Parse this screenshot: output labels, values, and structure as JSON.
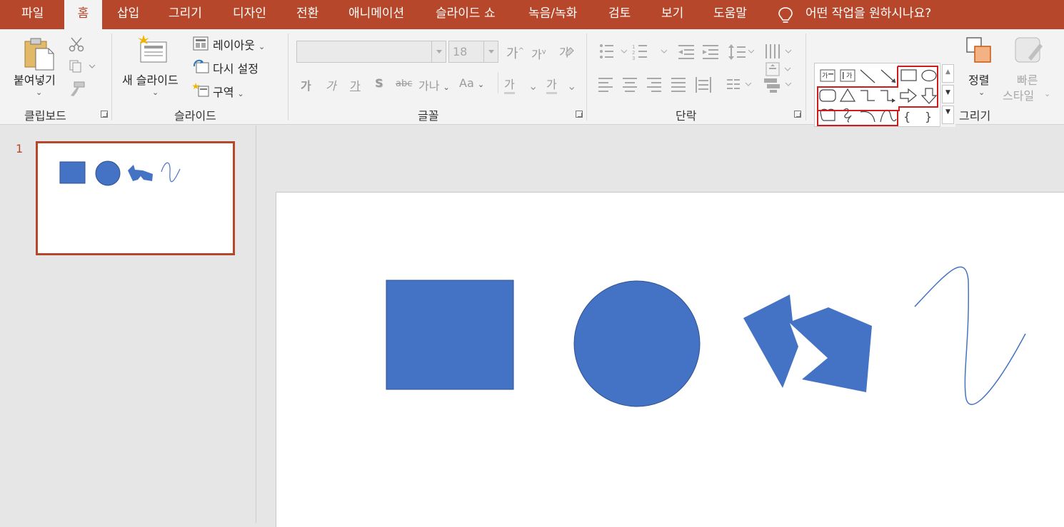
{
  "tabs": [
    {
      "label": "파일",
      "active": false
    },
    {
      "label": "홈",
      "active": true
    },
    {
      "label": "삽입",
      "active": false
    },
    {
      "label": "그리기",
      "active": false
    },
    {
      "label": "디자인",
      "active": false
    },
    {
      "label": "전환",
      "active": false
    },
    {
      "label": "애니메이션",
      "active": false
    },
    {
      "label": "슬라이드 쇼",
      "active": false
    },
    {
      "label": "녹음/녹화",
      "active": false
    },
    {
      "label": "검토",
      "active": false
    },
    {
      "label": "보기",
      "active": false
    },
    {
      "label": "도움말",
      "active": false
    }
  ],
  "tell_me": {
    "text": "어떤 작업을 원하시나요?",
    "icon": "lightbulb-icon"
  },
  "clipboard": {
    "paste_label": "붙여넣기",
    "group_label": "클립보드",
    "icons": [
      "paste-icon",
      "cut-icon",
      "copy-icon",
      "format-painter-icon"
    ]
  },
  "slides_group": {
    "new_slide_label": "새 슬라이드",
    "layout_label": "레이아웃",
    "reset_label": "다시 설정",
    "section_label": "구역",
    "group_label": "슬라이드"
  },
  "font": {
    "font_name": "",
    "font_size": "18",
    "increase_label": "가",
    "decrease_label": "가",
    "clear_label": "가",
    "bold_label": "가",
    "italic_label": "가",
    "underline_label": "가",
    "shadow_label": "S",
    "strike_label": "abc",
    "spacing_label": "가나",
    "case_label": "Aa",
    "highlight_label": "가",
    "color_label": "가",
    "group_label": "글꼴"
  },
  "paragraph": {
    "group_label": "단락"
  },
  "drawing": {
    "arrange_label": "정렬",
    "quick_styles_line1": "빠른",
    "quick_styles_line2": "스타일",
    "group_label": "그리기"
  },
  "slide_panel": {
    "slide_number": "1"
  },
  "slide": {
    "shapes": [
      "rectangle",
      "oval",
      "freeform",
      "curve"
    ],
    "shape_fill": "#4472c4",
    "shape_stroke": "#2f528f"
  },
  "colors": {
    "accent": "#b7472a",
    "ribbon": "#f3f3f3",
    "workspace": "#e6e6e6"
  }
}
